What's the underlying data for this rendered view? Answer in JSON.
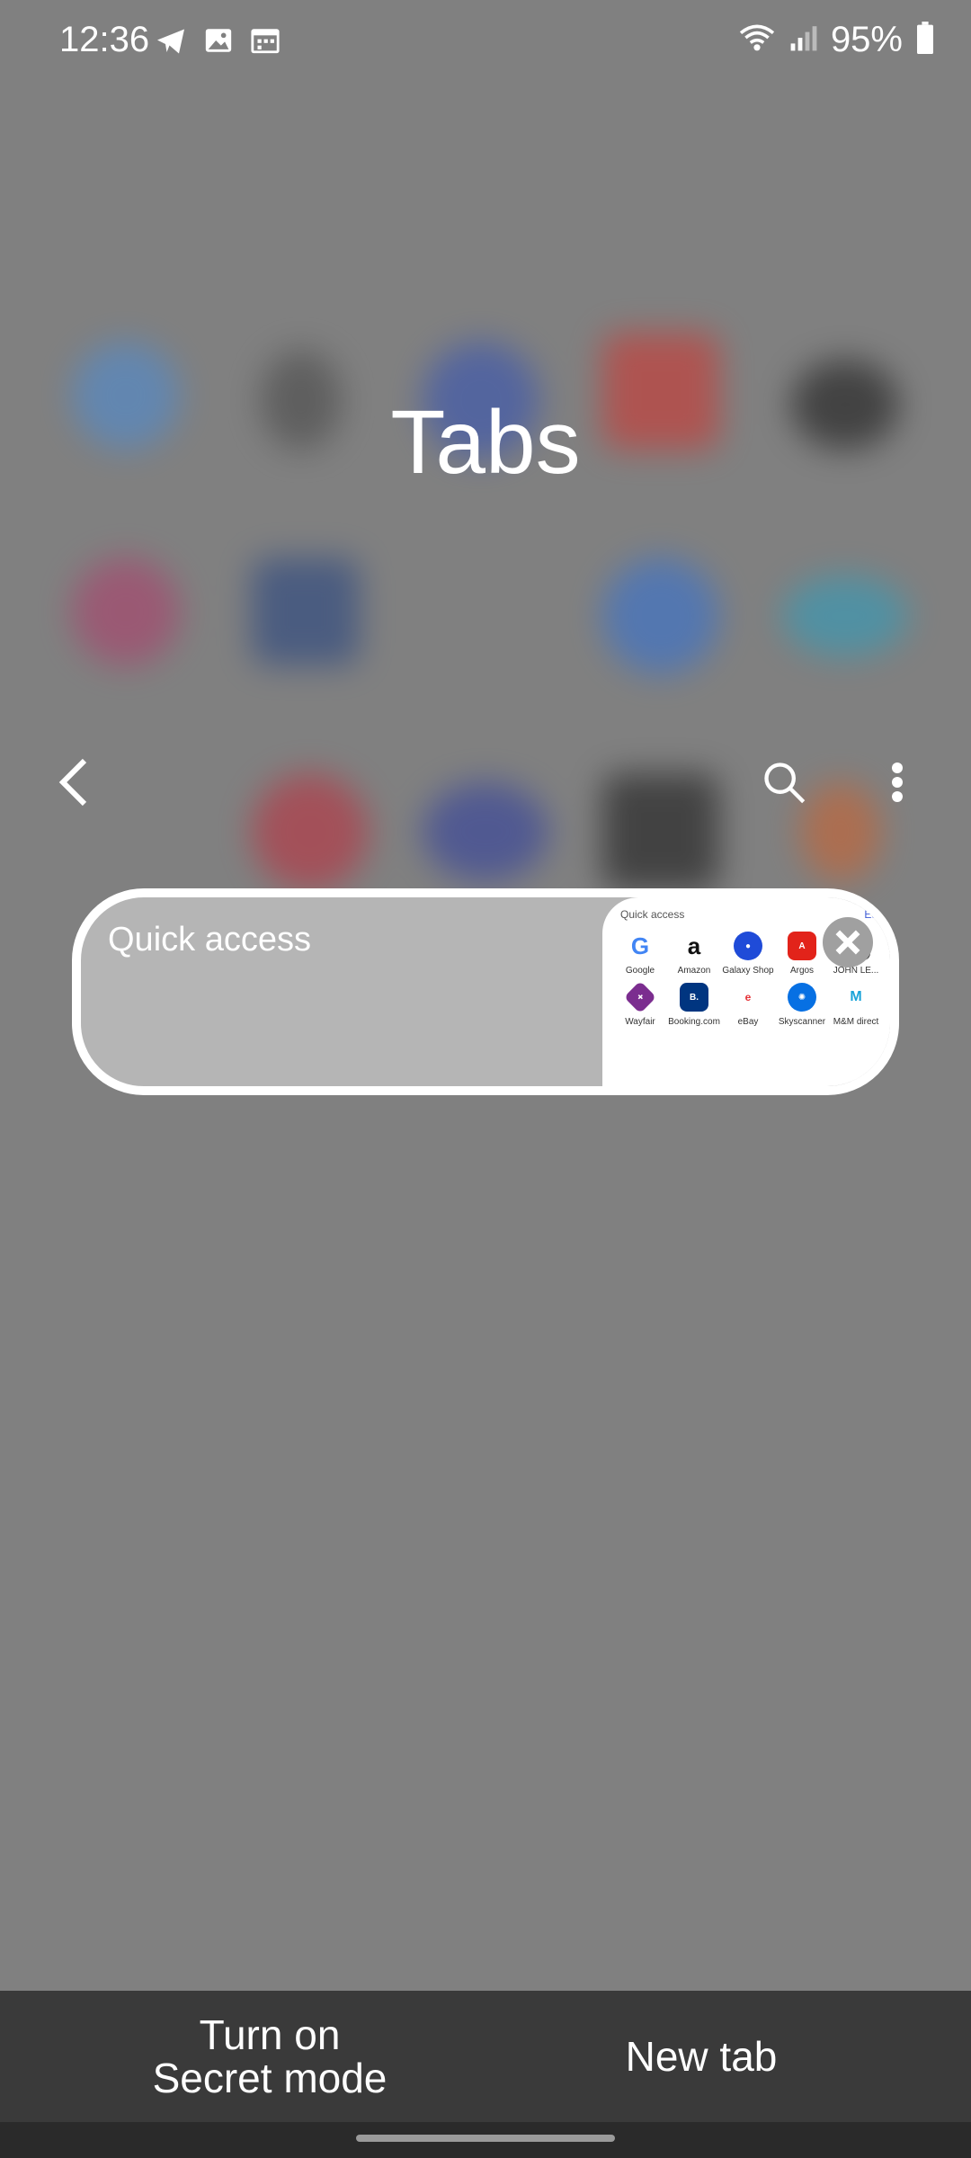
{
  "status": {
    "time": "12:36",
    "battery": "95%"
  },
  "title": "Tabs",
  "toolbar": {
    "back_icon": "chevron-left-icon",
    "search_icon": "search-icon",
    "more_icon": "more-vertical-icon"
  },
  "tab": {
    "title": "Quick access",
    "thumbnail": {
      "header": "Quick access",
      "edit": "Edit",
      "items": [
        {
          "label": "Google",
          "color": "#ffffff"
        },
        {
          "label": "Amazon",
          "color": "#ffffff"
        },
        {
          "label": "Galaxy Shop",
          "color": "#1f4bd8"
        },
        {
          "label": "Argos",
          "color": "#e2231a"
        },
        {
          "label": "JOHN LE...",
          "color": "#222222"
        },
        {
          "label": "Wayfair",
          "color": "#7b2d8f"
        },
        {
          "label": "Booking.com",
          "color": "#003580"
        },
        {
          "label": "eBay",
          "color": "#ffffff"
        },
        {
          "label": "Skyscanner",
          "color": "#0770e3"
        },
        {
          "label": "M&M direct",
          "color": "#ffffff"
        }
      ]
    }
  },
  "bottom": {
    "secret_line1": "Turn on",
    "secret_line2": "Secret mode",
    "new_tab": "New tab"
  }
}
